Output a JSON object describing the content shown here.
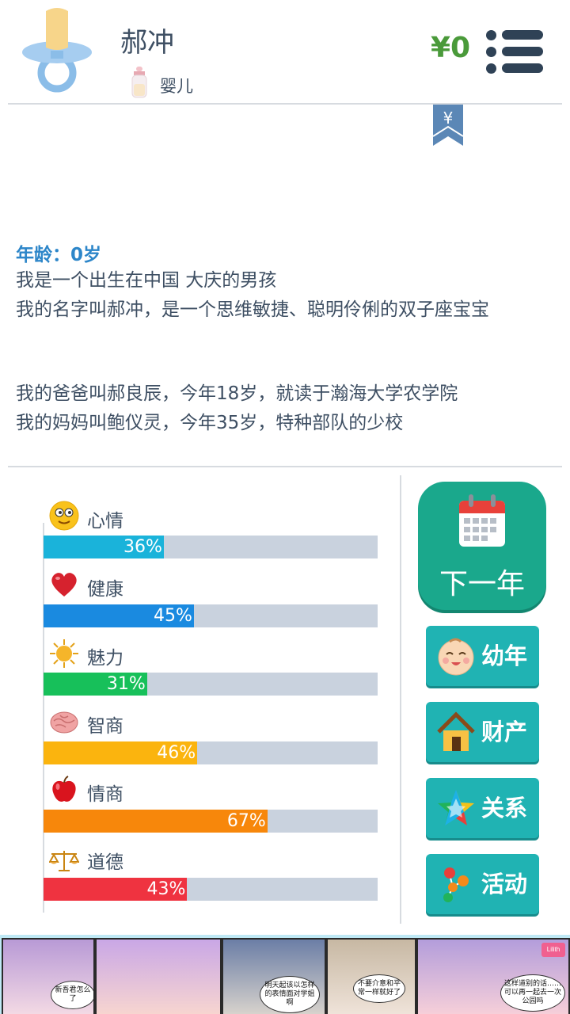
{
  "header": {
    "name": "郝冲",
    "stage": "婴儿",
    "money": "¥0",
    "ribbon_symbol": "¥"
  },
  "story": {
    "age_label": "年龄：0岁",
    "line1": "我是一个出生在中国 大庆的男孩",
    "line2": "我的名字叫郝冲，是一个思维敏捷、聪明伶俐的双子座宝宝",
    "line3": "我的爸爸叫郝良辰，今年18岁，就读于瀚海大学农学院",
    "line4": "我的妈妈叫鲍仪灵，今年35岁，特种部队的少校"
  },
  "stats": [
    {
      "label": "心情",
      "percent": 36,
      "percent_text": "36%",
      "color": "#1ab3da",
      "icon": "smiley-icon"
    },
    {
      "label": "健康",
      "percent": 45,
      "percent_text": "45%",
      "color": "#1a8ae0",
      "icon": "heart-icon"
    },
    {
      "label": "魅力",
      "percent": 31,
      "percent_text": "31%",
      "color": "#17c05a",
      "icon": "sun-icon"
    },
    {
      "label": "智商",
      "percent": 46,
      "percent_text": "46%",
      "color": "#fbb40e",
      "icon": "brain-icon"
    },
    {
      "label": "情商",
      "percent": 67,
      "percent_text": "67%",
      "color": "#f7870b",
      "icon": "apple-icon"
    },
    {
      "label": "道德",
      "percent": 43,
      "percent_text": "43%",
      "color": "#ef3340",
      "icon": "scale-icon"
    }
  ],
  "buttons": {
    "next_year": "下一年",
    "childhood": "幼年",
    "property": "财产",
    "relations": "关系",
    "activities": "活动"
  },
  "ad": {
    "bubble1": "新吾君怎么了",
    "bubble2": "明天起该以怎样的表情面对学姐啊",
    "bubble3": "不要介意和平常一样就好了",
    "bubble4": "这样道别的话……可以再一起去一次公园吗",
    "logo": "Lilith"
  },
  "colors": {
    "accent_green": "#1aa88c",
    "teal": "#20b3b3",
    "money_green": "#4a9a3a",
    "age_blue": "#2d86c9"
  }
}
